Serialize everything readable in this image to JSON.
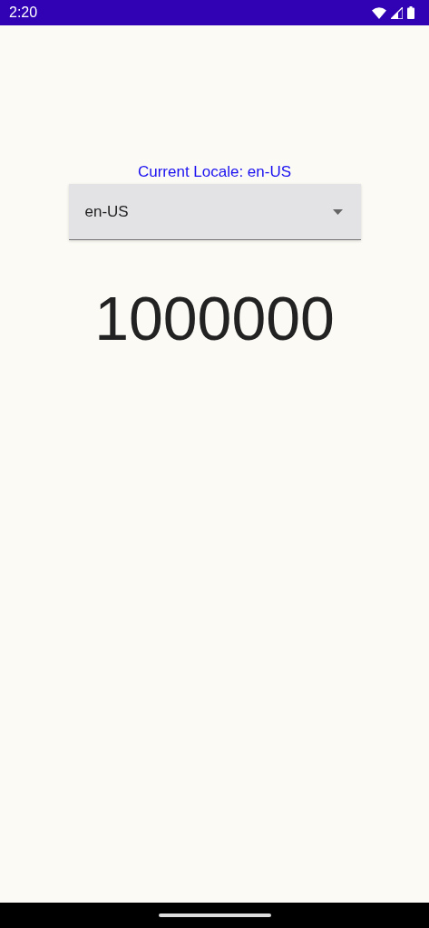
{
  "status_bar": {
    "time": "2:20"
  },
  "current_locale": "Current Locale: en-US",
  "locale_dropdown": {
    "value": "en-US"
  },
  "formatted_number": "1000000"
}
